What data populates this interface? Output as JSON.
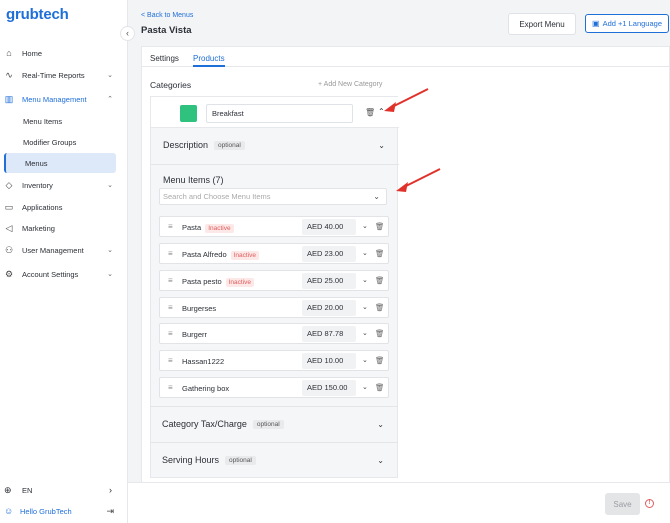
{
  "brand": {
    "logo_text": "grubtech"
  },
  "sidebar": {
    "collapse_icon": "chevron-left-icon",
    "items": [
      {
        "label": "Home",
        "icon": "home-icon"
      },
      {
        "label": "Real-Time Reports",
        "icon": "pulse-icon"
      },
      {
        "label": "Menu Management",
        "icon": "book-icon"
      },
      {
        "label": "Inventory",
        "icon": "box-icon"
      },
      {
        "label": "Applications",
        "icon": "monitor-icon"
      },
      {
        "label": "Marketing",
        "icon": "megaphone-icon"
      },
      {
        "label": "User Management",
        "icon": "users-icon"
      },
      {
        "label": "Account Settings",
        "icon": "gear-icon"
      }
    ],
    "sub_items": [
      {
        "label": "Menu Items"
      },
      {
        "label": "Modifier Groups"
      },
      {
        "label": "Menus"
      }
    ],
    "language": "EN",
    "user_greeting": "Hello GrubTech"
  },
  "header": {
    "back_label": "< Back to Menus",
    "title": "Pasta Vista",
    "export_label": "Export Menu",
    "add_language_label": "Add +1 Language"
  },
  "tabs": [
    {
      "label": "Settings"
    },
    {
      "label": "Products"
    }
  ],
  "categories": {
    "label": "Categories",
    "add_label": "+ Add New Category",
    "current": {
      "name": "Breakfast",
      "color": "#2ec27e",
      "description_title": "Description",
      "optional_label": "optional",
      "menu_items_title": "Menu Items (7)",
      "search_placeholder": "Search and Choose Menu Items",
      "items": [
        {
          "name": "Pasta",
          "status": "Inactive",
          "price": "AED 40.00"
        },
        {
          "name": "Pasta Alfredo",
          "status": "Inactive",
          "price": "AED 23.00"
        },
        {
          "name": "Pasta pesto",
          "status": "Inactive",
          "price": "AED 25.00"
        },
        {
          "name": "Burgerses",
          "status": "",
          "price": "AED 20.00"
        },
        {
          "name": "Burgerr",
          "status": "",
          "price": "AED 87.78"
        },
        {
          "name": "Hassan1222",
          "status": "",
          "price": "AED 10.00"
        },
        {
          "name": "Gathering box",
          "status": "",
          "price": "AED 150.00"
        }
      ],
      "tax_title": "Category Tax/Charge",
      "serving_title": "Serving Hours"
    }
  },
  "footer": {
    "save_label": "Save",
    "error_icon": "alert-circle-icon"
  },
  "colors": {
    "accent": "#1f6fd8",
    "inactive": "#e05c5c",
    "annotation_arrow": "#e0322b"
  }
}
